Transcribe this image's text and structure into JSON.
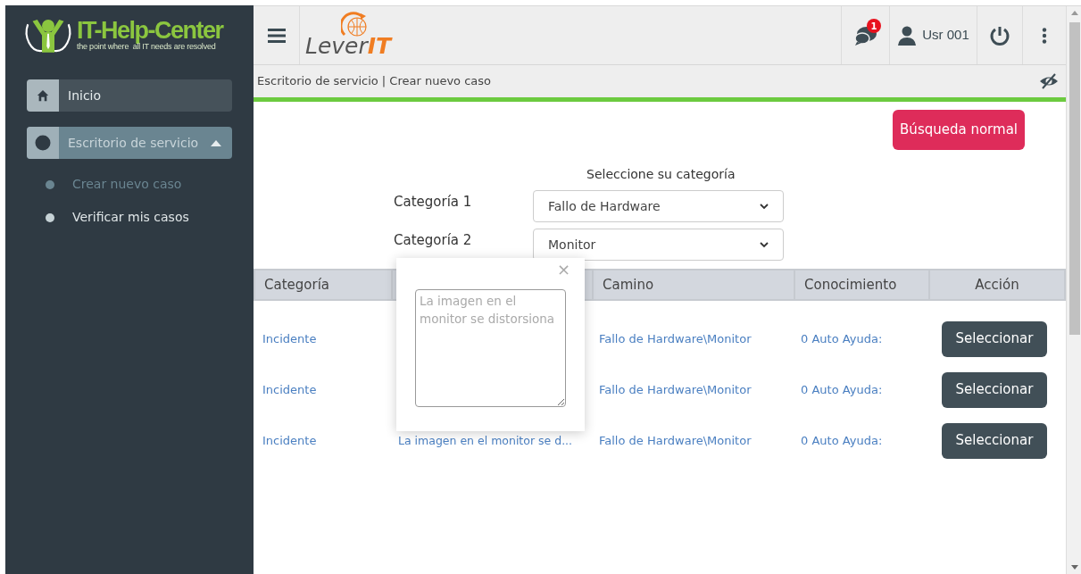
{
  "logo": {
    "title": "IT-Help-Center",
    "tagline": "the point where  all IT needs are resolved"
  },
  "sidebar": {
    "items": [
      {
        "label": "Inicio",
        "kind": "home"
      },
      {
        "label": "Escritorio de servicio",
        "kind": "group",
        "expanded": true,
        "children": [
          {
            "label": "Crear nuevo caso",
            "selected": true
          },
          {
            "label": "Verificar mis casos",
            "selected": false
          }
        ]
      }
    ]
  },
  "header": {
    "brand": {
      "word": "Lever",
      "accent": "IT"
    },
    "notifications": "1",
    "user": "Usr 001"
  },
  "breadcrumb": "Escritorio de servicio | Crear nuevo caso",
  "search_button": "Búsqueda normal",
  "category_title": "Seleccione su categoría",
  "categories": [
    {
      "label": "Categoría 1",
      "value": "Fallo de Hardware"
    },
    {
      "label": "Categoría 2",
      "value": "Monitor"
    }
  ],
  "table": {
    "columns": [
      "Categoría",
      null,
      "Camino",
      "Conocimiento",
      "Acción"
    ],
    "rows": [
      {
        "category": "Incidente",
        "description": null,
        "path": "Fallo de Hardware\\Monitor",
        "knowledge": "0 Auto Ayuda:",
        "action": "Seleccionar"
      },
      {
        "category": "Incidente",
        "description": null,
        "path": "Fallo de Hardware\\Monitor",
        "knowledge": "0 Auto Ayuda:",
        "action": "Seleccionar"
      },
      {
        "category": "Incidente",
        "description": "La imagen en el monitor se d...",
        "path": "Fallo de Hardware\\Monitor",
        "knowledge": "0 Auto Ayuda:",
        "action": "Seleccionar"
      }
    ]
  },
  "popup": {
    "close": "×",
    "placeholder": "La imagen en el monitor se distorsiona"
  }
}
